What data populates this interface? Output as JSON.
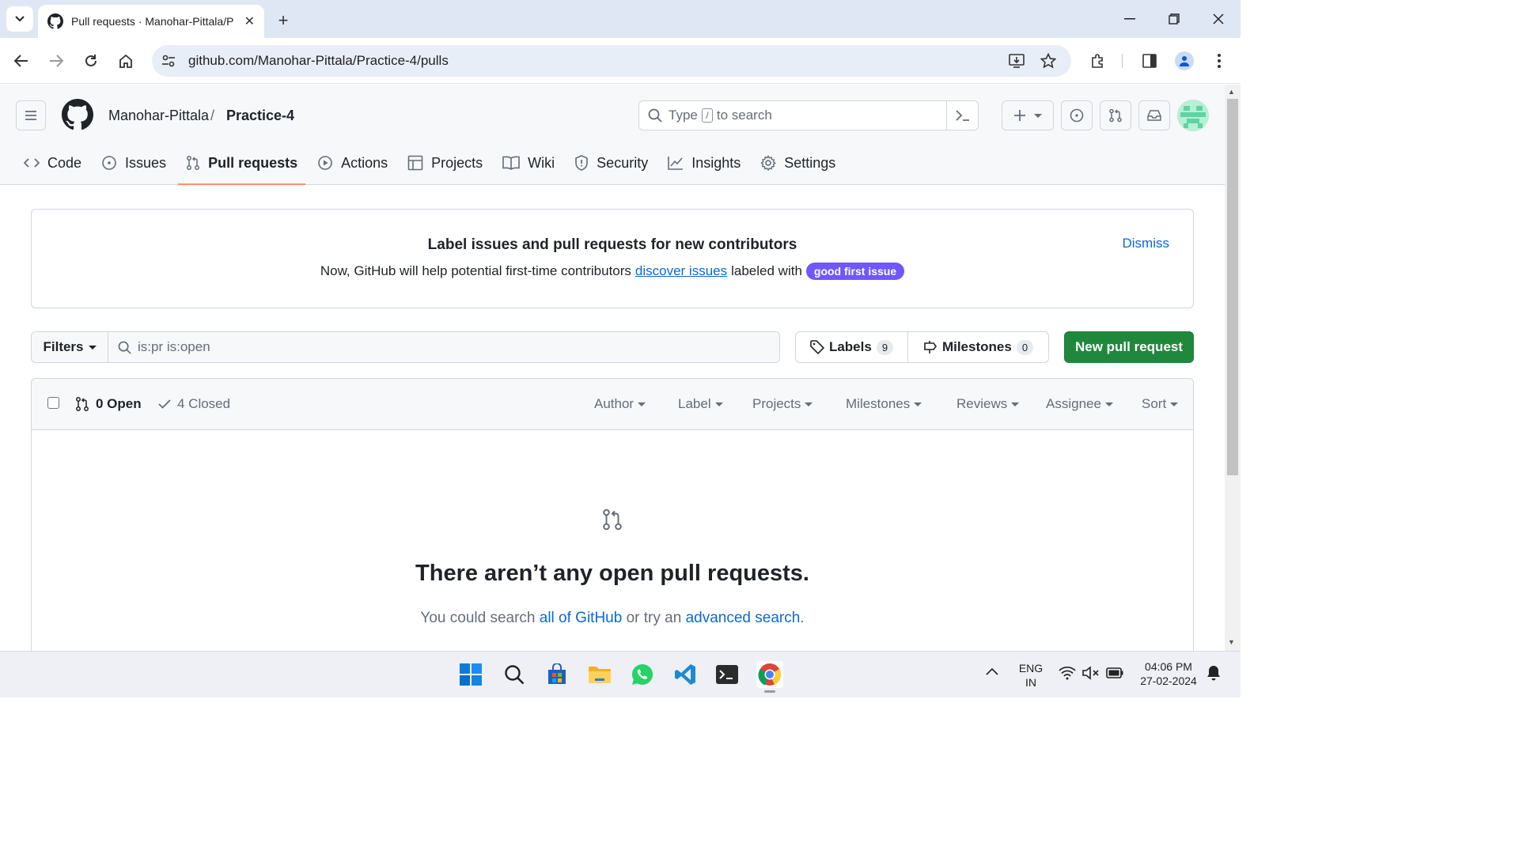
{
  "browser": {
    "tab_title": "Pull requests · Manohar-Pittala/Practice-4",
    "url": "github.com/Manohar-Pittala/Practice-4/pulls"
  },
  "header": {
    "owner": "Manohar-Pittala",
    "separator": "/",
    "repo": "Practice-4",
    "search_placeholder_prefix": "Type",
    "search_key": "/",
    "search_placeholder_suffix": "to search"
  },
  "repo_nav": [
    {
      "label": "Code",
      "icon": "code-icon"
    },
    {
      "label": "Issues",
      "icon": "issue-icon"
    },
    {
      "label": "Pull requests",
      "icon": "pull-request-icon",
      "active": true
    },
    {
      "label": "Actions",
      "icon": "play-icon"
    },
    {
      "label": "Projects",
      "icon": "table-icon"
    },
    {
      "label": "Wiki",
      "icon": "book-icon"
    },
    {
      "label": "Security",
      "icon": "shield-icon"
    },
    {
      "label": "Insights",
      "icon": "graph-icon"
    },
    {
      "label": "Settings",
      "icon": "gear-icon"
    }
  ],
  "banner": {
    "title": "Label issues and pull requests for new contributors",
    "text_before": "Now, GitHub will help potential first-time contributors",
    "link": "discover issues",
    "text_after": "labeled with",
    "label": "good first issue",
    "dismiss": "Dismiss"
  },
  "filter_bar": {
    "filters_label": "Filters",
    "query": "is:pr is:open",
    "labels_label": "Labels",
    "labels_count": "9",
    "milestones_label": "Milestones",
    "milestones_count": "0",
    "new_pr_label": "New pull request"
  },
  "list_header": {
    "open": "0 Open",
    "closed": "4 Closed",
    "selectors": [
      "Author",
      "Label",
      "Projects",
      "Milestones",
      "Reviews",
      "Assignee",
      "Sort"
    ]
  },
  "blankslate": {
    "title": "There aren’t any open pull requests.",
    "text_before": "You could search",
    "link1": "all of GitHub",
    "text_middle": "or try an",
    "link2": "advanced search",
    "text_after": "."
  },
  "taskbar": {
    "lang_line1": "ENG",
    "lang_line2": "IN",
    "time": "04:06 PM",
    "date": "27-02-2024"
  },
  "colors": {
    "primary_button": "#1f883d",
    "link": "#0969da",
    "active_tab_underline": "#fd8c73",
    "good_first_issue": "#7057ff"
  }
}
